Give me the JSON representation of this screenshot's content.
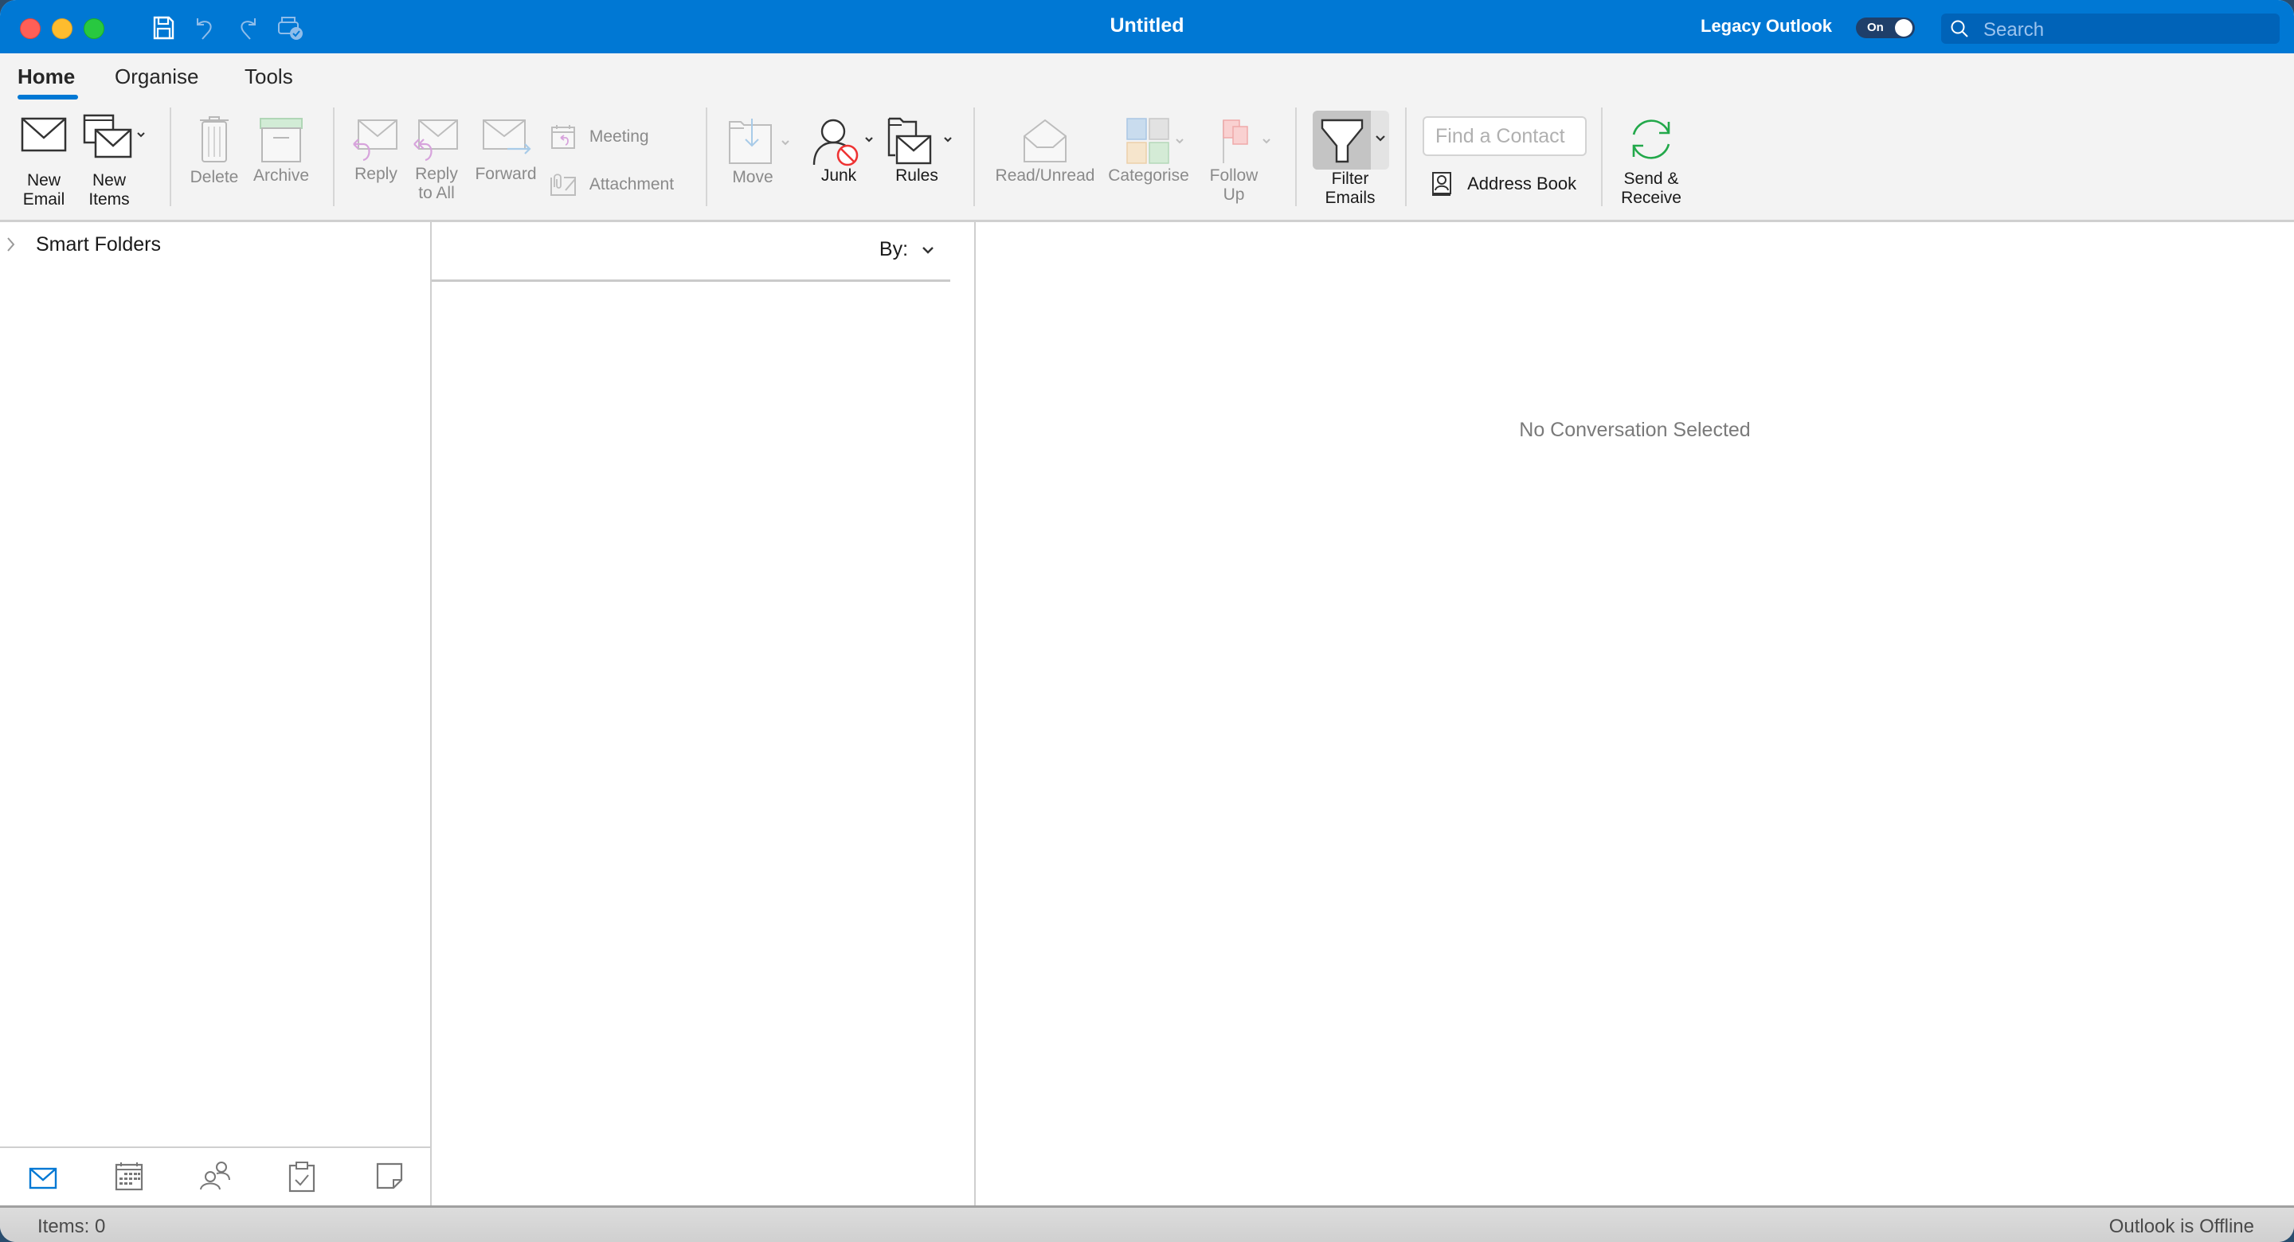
{
  "window": {
    "title": "Untitled",
    "legacy_label": "Legacy Outlook",
    "legacy_toggle": "On",
    "search_placeholder": "Search",
    "accent": "#0078d4"
  },
  "quick_access": [
    "save-icon",
    "undo-icon",
    "redo-icon",
    "print-icon"
  ],
  "tabs": [
    {
      "label": "Home",
      "active": true
    },
    {
      "label": "Organise",
      "active": false
    },
    {
      "label": "Tools",
      "active": false
    }
  ],
  "ribbon": {
    "new_email": [
      "New",
      "Email"
    ],
    "new_items": [
      "New",
      "Items"
    ],
    "delete": "Delete",
    "archive": "Archive",
    "reply": "Reply",
    "reply_all": [
      "Reply",
      "to All"
    ],
    "forward": "Forward",
    "meeting": "Meeting",
    "attachment": "Attachment",
    "move": "Move",
    "junk": "Junk",
    "rules": "Rules",
    "read_unread": "Read/Unread",
    "categorise": "Categorise",
    "follow_up": [
      "Follow",
      "Up"
    ],
    "filter_emails": [
      "Filter",
      "Emails"
    ],
    "find_contact_placeholder": "Find a Contact",
    "address_book": "Address Book",
    "send_receive": [
      "Send &",
      "Receive"
    ]
  },
  "folders": {
    "smart_folders": "Smart Folders"
  },
  "nav": [
    "mail-icon",
    "calendar-icon",
    "people-icon",
    "tasks-icon",
    "notes-icon"
  ],
  "list": {
    "sort_label": "By:"
  },
  "reading": {
    "empty_text": "No Conversation Selected"
  },
  "status": {
    "items": "Items: 0",
    "connection": "Outlook is Offline"
  }
}
